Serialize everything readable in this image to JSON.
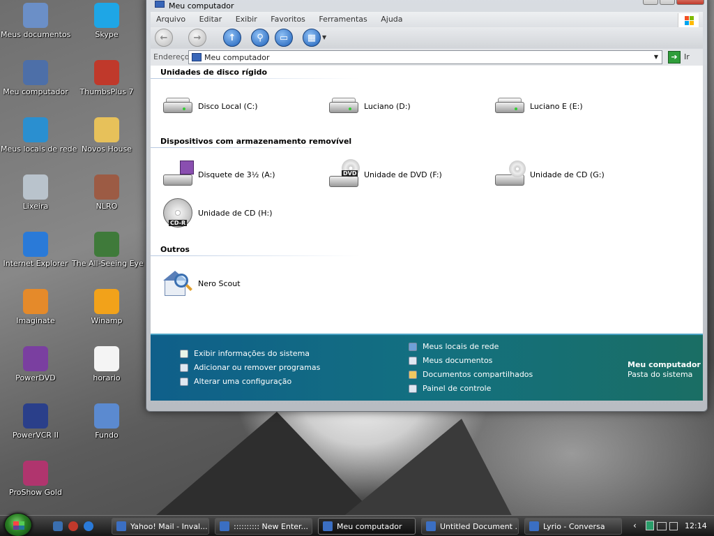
{
  "desktop": {
    "icons": [
      {
        "label": "Meus documentos",
        "icon": "documents-icon",
        "color": "#6b8fc7"
      },
      {
        "label": "Skype",
        "icon": "skype-icon",
        "color": "#1ea6e6"
      },
      {
        "label": "Meu computador",
        "icon": "computer-icon",
        "color": "#4d6fa8"
      },
      {
        "label": "ThumbsPlus 7",
        "icon": "thumbsplus-icon",
        "color": "#c0392b"
      },
      {
        "label": "Meus locais de rede",
        "icon": "network-icon",
        "color": "#2a8fd0"
      },
      {
        "label": "Novos House",
        "icon": "folder-icon",
        "color": "#e7c15a"
      },
      {
        "label": "Lixeira",
        "icon": "recycle-bin-icon",
        "color": "#b9c3cc"
      },
      {
        "label": "NLRO",
        "icon": "nlro-icon",
        "color": "#9c5b44"
      },
      {
        "label": "Internet Explorer",
        "icon": "ie-icon",
        "color": "#2a7ad8"
      },
      {
        "label": "The All-Seeing Eye",
        "icon": "eye-icon",
        "color": "#3f7a3a"
      },
      {
        "label": "Imaginate",
        "icon": "imaginate-icon",
        "color": "#e58a2a"
      },
      {
        "label": "Winamp",
        "icon": "winamp-icon",
        "color": "#f2a21a"
      },
      {
        "label": "PowerDVD",
        "icon": "powerdvd-icon",
        "color": "#7a3fa0"
      },
      {
        "label": "horario",
        "icon": "text-file-icon",
        "color": "#f4f4f4"
      },
      {
        "label": "PowerVCR II",
        "icon": "powervcr-icon",
        "color": "#2a3f8a"
      },
      {
        "label": "Fundo",
        "icon": "image-file-icon",
        "color": "#5b8ad0"
      },
      {
        "label": "ProShow Gold",
        "icon": "proshow-icon",
        "color": "#b0356e"
      }
    ]
  },
  "window": {
    "title": "Meu computador",
    "menu": [
      "Arquivo",
      "Editar",
      "Exibir",
      "Favoritos",
      "Ferramentas",
      "Ajuda"
    ],
    "toolbar": {
      "back": "back-icon",
      "forward": "forward-icon",
      "up": "up-folder-icon",
      "search": "search-icon",
      "folders": "folders-icon",
      "views": "views-icon"
    },
    "address": {
      "label": "Endereço",
      "value": "Meu computador",
      "go_label": "Ir"
    },
    "groups": {
      "hard_disks": "Unidades de disco rígido",
      "removable": "Dispositivos com armazenamento removível",
      "others": "Outros"
    },
    "hard_disks": [
      "Disco Local (C:)",
      "Luciano (D:)",
      "Luciano E (E:)"
    ],
    "removable": [
      {
        "label": "Disquete de 3½ (A:)",
        "icon": "floppy-drive-icon"
      },
      {
        "label": "Unidade de DVD (F:)",
        "icon": "dvd-drive-icon",
        "tag": "DVD"
      },
      {
        "label": "Unidade de CD (G:)",
        "icon": "cd-drive-icon"
      },
      {
        "label": "Unidade de CD (H:)",
        "icon": "cd-r-disc-icon",
        "tag": "CD-R"
      }
    ],
    "others": [
      "Nero Scout"
    ],
    "tasks_left": [
      "Exibir informações do sistema",
      "Adicionar ou remover programas",
      "Alterar uma configuração"
    ],
    "tasks_right": [
      "Meus locais de rede",
      "Meus documentos",
      "Documentos compartilhados",
      "Painel de controle"
    ],
    "details_title": "Meu computador",
    "details_subtitle": "Pasta do sistema"
  },
  "taskbar": {
    "buttons": [
      "Yahoo! Mail - Inval...",
      ":::::::::: New Enter...",
      "Meu computador",
      "Untitled Document ...",
      "Lyrio - Conversa"
    ],
    "active_index": 2,
    "clock": "12:14"
  },
  "colors": {
    "task_pane": "#137080",
    "taskbar": "#2a2a2a"
  }
}
